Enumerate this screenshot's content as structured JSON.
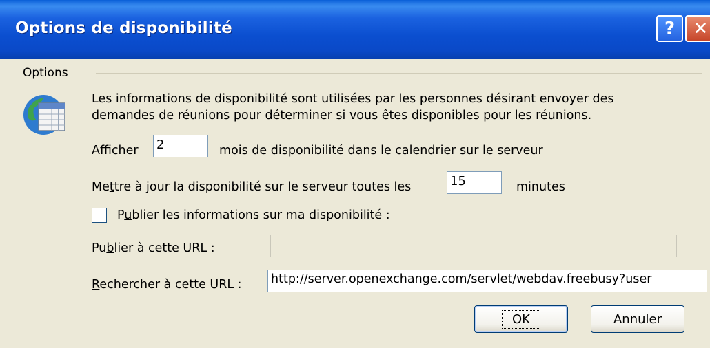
{
  "window": {
    "title": "Options de disponibilité"
  },
  "titlebar": {
    "help_glyph": "?",
    "close_glyph": "✕"
  },
  "options": {
    "group_label": "Options",
    "icon": "calendar-globe-icon",
    "description_line1": "Les informations de disponibilité sont utilisées par les personnes désirant envoyer des",
    "description_line2": "demandes de réunions pour déterminer si vous êtes disponibles pour les réunions.",
    "show": {
      "label_pre": "Affi",
      "label_access": "c",
      "label_post": "her",
      "value": "2",
      "suffix_access": "m",
      "suffix_rest": "ois de disponibilité dans le calendrier sur le serveur"
    },
    "update": {
      "label_pre": "Me",
      "label_access": "t",
      "label_post": "tre à jour la disponibilité sur le serveur toutes les",
      "value": "15",
      "suffix": "minutes"
    },
    "publish": {
      "checked": false,
      "label_pre": "P",
      "label_access": "u",
      "label_post": "blier les informations sur ma disponibilité :"
    },
    "publish_url": {
      "label_pre": "Pu",
      "label_access": "b",
      "label_post": "lier à cette URL :",
      "value": ""
    },
    "search_url": {
      "label_access": "R",
      "label_post": "echercher à cette URL :",
      "value": "http://server.openexchange.com/servlet/webdav.freebusy?user"
    }
  },
  "buttons": {
    "ok": "OK",
    "cancel": "Annuler"
  }
}
